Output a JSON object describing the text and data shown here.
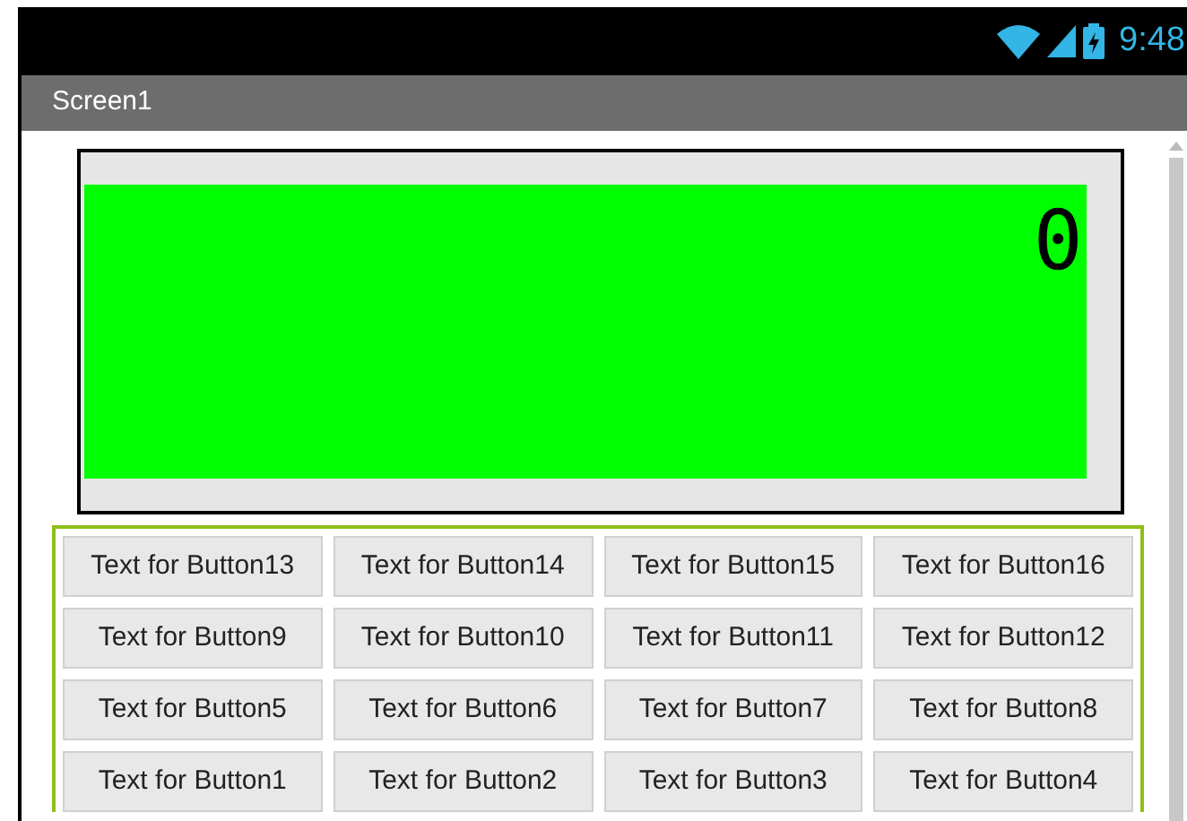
{
  "status_bar": {
    "time": "9:48"
  },
  "title_bar": {
    "title": "Screen1"
  },
  "display": {
    "value": "0"
  },
  "button_rows": [
    [
      "Text for Button13",
      "Text for Button14",
      "Text for Button15",
      "Text for Button16"
    ],
    [
      "Text for Button9",
      "Text for Button10",
      "Text for Button11",
      "Text for Button12"
    ],
    [
      "Text for Button5",
      "Text for Button6",
      "Text for Button7",
      "Text for Button8"
    ],
    [
      "Text for Button1",
      "Text for Button2",
      "Text for Button3",
      "Text for Button4"
    ]
  ]
}
